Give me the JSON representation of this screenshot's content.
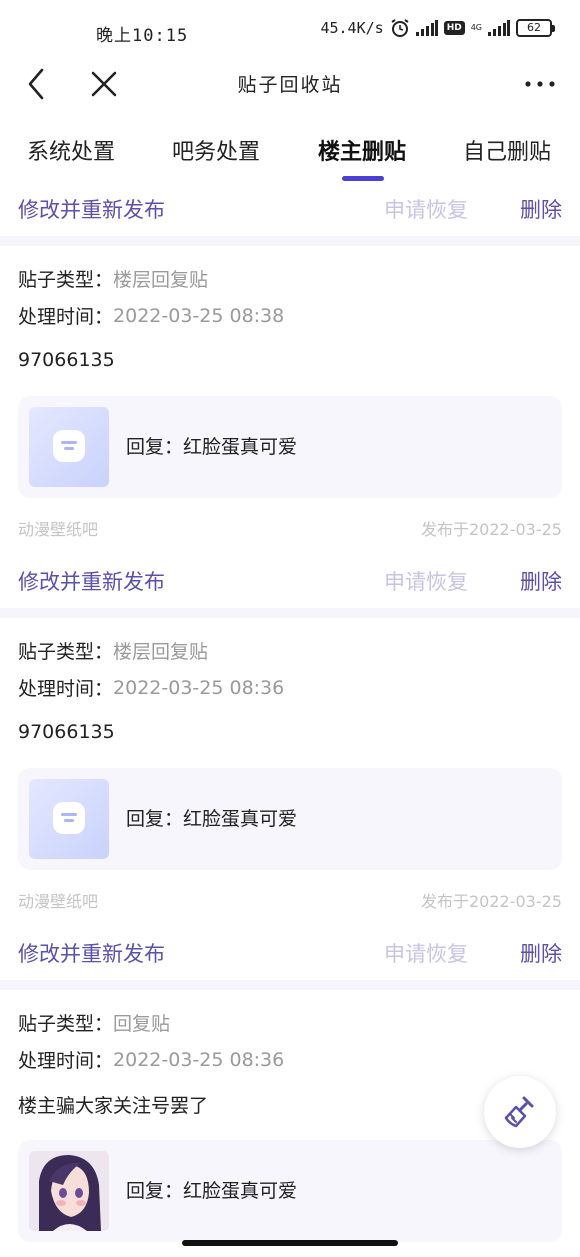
{
  "status_bar": {
    "time": "晚上10:15",
    "speed": "45.4K/s",
    "network": "4G",
    "hd": "HD",
    "battery": "62"
  },
  "nav": {
    "title": "贴子回收站"
  },
  "tabs": [
    {
      "label": "系统处置"
    },
    {
      "label": "吧务处置"
    },
    {
      "label": "楼主删贴"
    },
    {
      "label": "自己删贴"
    }
  ],
  "actions": {
    "edit_label": "修改并重新发布",
    "restore_label": "申请恢复",
    "delete_label": "删除"
  },
  "posts": [
    {
      "type_label": "贴子类型：",
      "type_value": "楼层回复贴",
      "time_label": "处理时间：",
      "time_value": "2022-03-25 08:38",
      "body": "97066135",
      "reply": "回复：红脸蛋真可爱",
      "forum": "动漫壁纸吧",
      "published": "发布于2022-03-25"
    },
    {
      "type_label": "贴子类型：",
      "type_value": "楼层回复贴",
      "time_label": "处理时间：",
      "time_value": "2022-03-25 08:36",
      "body": "97066135",
      "reply": "回复：红脸蛋真可爱",
      "forum": "动漫壁纸吧",
      "published": "发布于2022-03-25"
    },
    {
      "type_label": "贴子类型：",
      "type_value": "回复贴",
      "time_label": "处理时间：",
      "time_value": "2022-03-25 08:36",
      "body": "楼主骗大家关注号罢了",
      "reply": "回复：红脸蛋真可爱"
    }
  ],
  "colors": {
    "accent": "#4b3fd6",
    "action": "#5b4fb0",
    "action_disabled": "#c9c3e4"
  }
}
